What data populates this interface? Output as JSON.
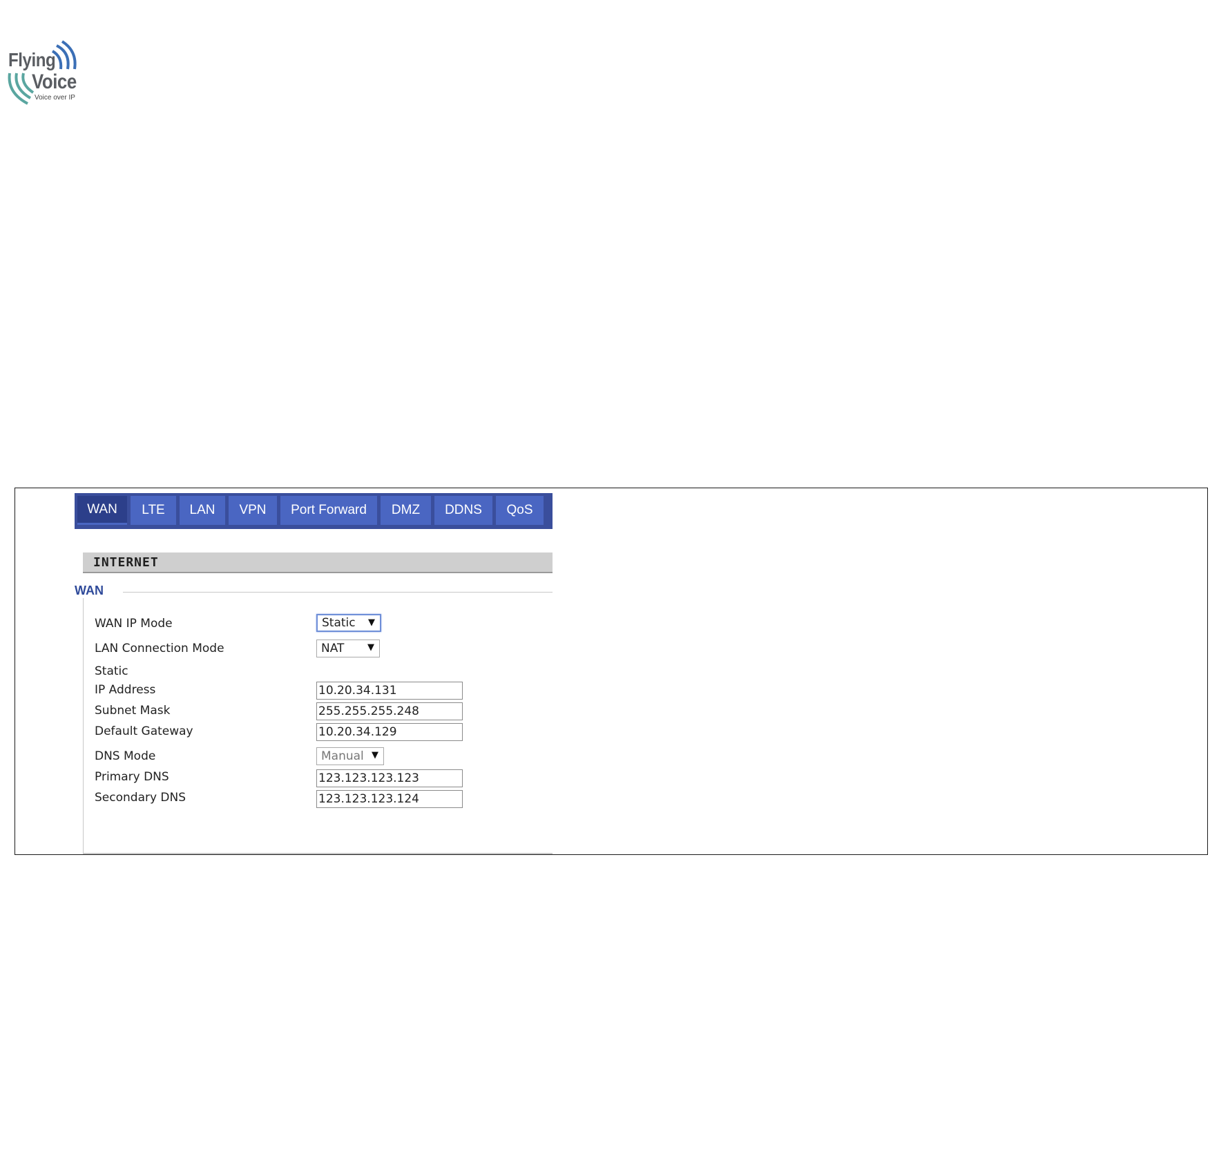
{
  "logo": {
    "line1": "Flying",
    "line2": "Voice",
    "tagline": "Voice over IP",
    "colors": {
      "text": "#5a5d62",
      "waves_blue": "#3b6fb6",
      "waves_teal": "#5aa6a0"
    }
  },
  "tabs": [
    {
      "label": "WAN",
      "active": true
    },
    {
      "label": "LTE",
      "active": false
    },
    {
      "label": "LAN",
      "active": false
    },
    {
      "label": "VPN",
      "active": false
    },
    {
      "label": "Port Forward",
      "active": false
    },
    {
      "label": "DMZ",
      "active": false
    },
    {
      "label": "DDNS",
      "active": false
    },
    {
      "label": "QoS",
      "active": false
    }
  ],
  "section": {
    "title": "INTERNET"
  },
  "wan": {
    "legend": "WAN",
    "wan_ip_mode": {
      "label": "WAN IP Mode",
      "value": "Static"
    },
    "lan_connection_mode": {
      "label": "LAN Connection Mode",
      "value": "NAT"
    },
    "static_heading": "Static",
    "ip_address": {
      "label": "IP Address",
      "value": "10.20.34.131"
    },
    "subnet_mask": {
      "label": "Subnet Mask",
      "value": "255.255.255.248"
    },
    "default_gateway": {
      "label": "Default Gateway",
      "value": "10.20.34.129"
    },
    "dns_mode": {
      "label": "DNS Mode",
      "value": "Manual"
    },
    "primary_dns": {
      "label": "Primary DNS",
      "value": "123.123.123.123"
    },
    "secondary_dns": {
      "label": "Secondary DNS",
      "value": "123.123.123.124"
    }
  },
  "icons": {
    "dropdown": "chevron-down-icon"
  },
  "colors": {
    "tabbar": "#3a4e9c",
    "tab": "#4a66c2",
    "tab_active": "#2c3f8a",
    "legend": "#2f4a9a",
    "section_bar": "#cfcfcf"
  }
}
